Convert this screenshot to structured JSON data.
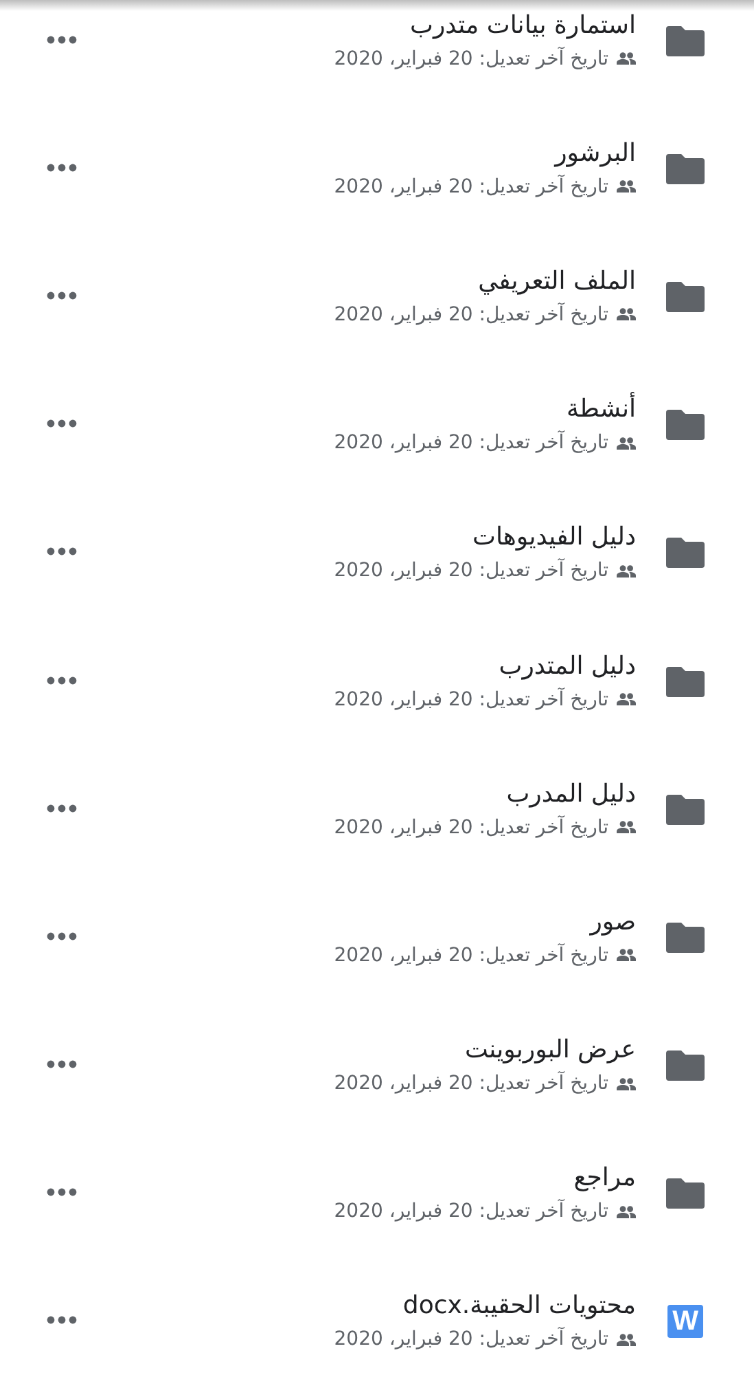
{
  "files": [
    {
      "kind": "folder",
      "title": "استمارة بيانات متدرب",
      "meta": "تاريخ آخر تعديل: 20 فبراير، 2020",
      "shared": true
    },
    {
      "kind": "folder",
      "title": "البرشور",
      "meta": "تاريخ آخر تعديل: 20 فبراير، 2020",
      "shared": true
    },
    {
      "kind": "folder",
      "title": "الملف التعريفي",
      "meta": "تاريخ آخر تعديل: 20 فبراير، 2020",
      "shared": true
    },
    {
      "kind": "folder",
      "title": "أنشطة",
      "meta": "تاريخ آخر تعديل: 20 فبراير، 2020",
      "shared": true
    },
    {
      "kind": "folder",
      "title": "دليل الفيديوهات",
      "meta": "تاريخ آخر تعديل: 20 فبراير، 2020",
      "shared": true
    },
    {
      "kind": "folder",
      "title": "دليل المتدرب",
      "meta": "تاريخ آخر تعديل: 20 فبراير، 2020",
      "shared": true
    },
    {
      "kind": "folder",
      "title": "دليل المدرب",
      "meta": "تاريخ آخر تعديل: 20 فبراير، 2020",
      "shared": true
    },
    {
      "kind": "folder",
      "title": "صور",
      "meta": "تاريخ آخر تعديل: 20 فبراير، 2020",
      "shared": true
    },
    {
      "kind": "folder",
      "title": "عرض البوربوينت",
      "meta": "تاريخ آخر تعديل: 20 فبراير، 2020",
      "shared": true
    },
    {
      "kind": "folder",
      "title": "مراجع",
      "meta": "تاريخ آخر تعديل: 20 فبراير، 2020",
      "shared": true
    },
    {
      "kind": "word",
      "icon_letter": "W",
      "title": "محتويات الحقيبة.docx",
      "meta": "تاريخ آخر تعديل: 20 فبراير، 2020",
      "shared": true
    }
  ]
}
